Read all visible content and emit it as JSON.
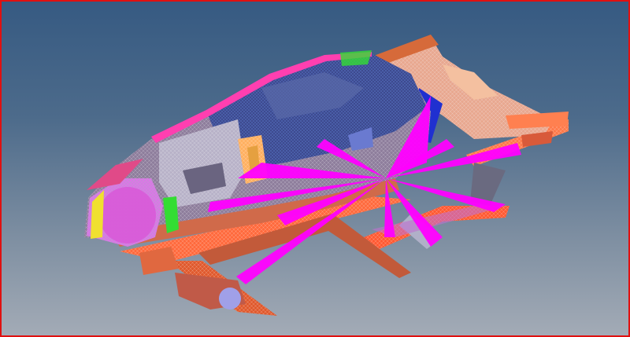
{
  "viewport": {
    "border_color": "#e01010",
    "background_top": "#365a82",
    "background_bottom": "#a3abb6"
  },
  "model": {
    "icon": "car-body-fe-mesh",
    "colors": {
      "roof_mesh": "#3d4a8f",
      "rbe_spider": "#ff00ff",
      "rails": "#ff6a3d",
      "pillar": "#ffb060",
      "door": "#b8b2c8",
      "wheel_arch": "#c78ad8",
      "accent_green": "#33dd33",
      "accent_yellow": "#f0e030",
      "accent_blue": "#2030d0"
    }
  }
}
